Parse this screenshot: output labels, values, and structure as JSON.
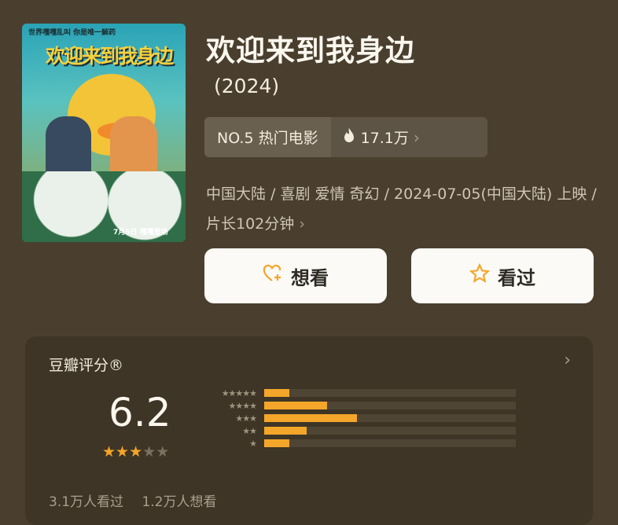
{
  "poster": {
    "tagline": "世界嘎嘎乱叫 你是唯一解药",
    "title": "欢迎来到我身边",
    "date_text": "7月5日 嘎嘎登场"
  },
  "movie": {
    "title": "欢迎来到我身边",
    "year": "(2024)",
    "rank": "NO.5 热门电影",
    "heat": "17.1万",
    "meta": "中国大陆 / 喜剧 爱情 奇幻 / 2024-07-05(中国大陆) 上映 / 片长102分钟"
  },
  "actions": {
    "want_label": "想看",
    "seen_label": "看过"
  },
  "rating": {
    "title": "豆瓣评分®",
    "score": "6.2",
    "stars_filled": 3,
    "stars_total": 5,
    "distribution": [
      {
        "stars": 5,
        "fraction": 0.1
      },
      {
        "stars": 4,
        "fraction": 0.25
      },
      {
        "stars": 3,
        "fraction": 0.37
      },
      {
        "stars": 2,
        "fraction": 0.17
      },
      {
        "stars": 1,
        "fraction": 0.1
      }
    ],
    "seen_count": "3.1万人看过",
    "want_count": "1.2万人想看"
  },
  "colors": {
    "background": "#4a3f2e",
    "accent": "#f4a62a"
  }
}
